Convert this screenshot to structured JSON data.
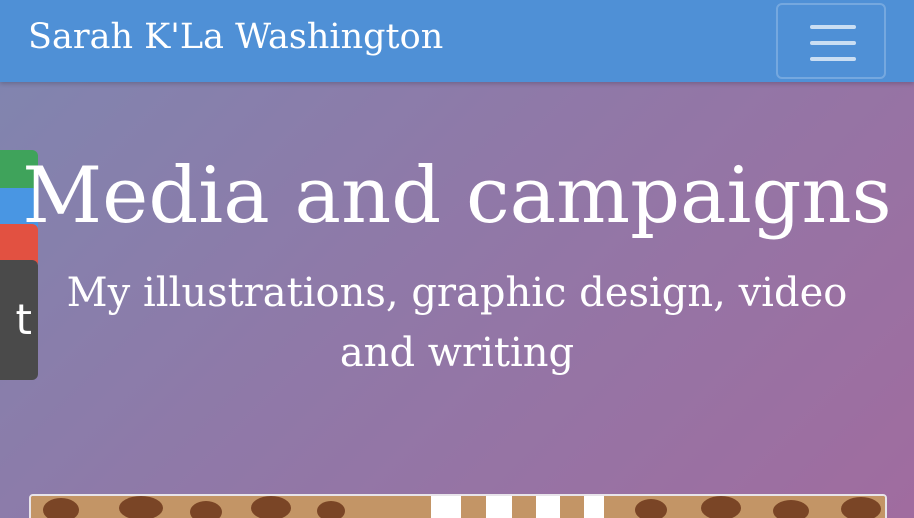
{
  "navbar": {
    "brand": "Sarah K'La Washington",
    "menu_icon": "hamburger-menu-icon"
  },
  "hero": {
    "title": "Media and campaigns",
    "subtitle": "My illustrations, graphic design, video and writing"
  },
  "share_sidebar": {
    "items": [
      {
        "color": "#3fa35b"
      },
      {
        "color": "#4996e3"
      },
      {
        "color": "#e25141"
      },
      {
        "color": "#4a4a4a",
        "label": "t"
      }
    ]
  },
  "colors": {
    "navbar": "#4f90d6",
    "gradient_start": "#7f86b0",
    "gradient_end": "#a06c9f"
  }
}
